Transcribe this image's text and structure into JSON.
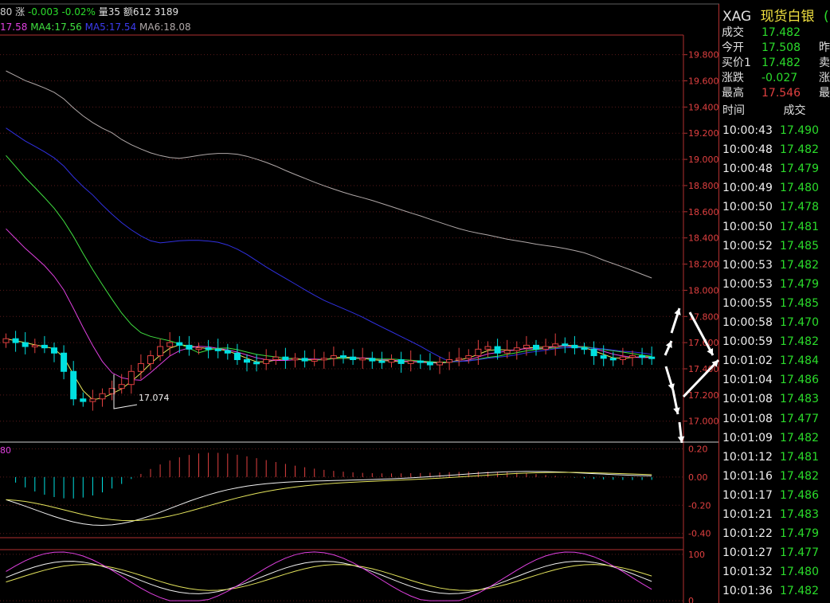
{
  "header": {
    "top_info": {
      "prefix": "80",
      "change_label": "涨",
      "change_value": "-0.003",
      "change_pct": "-0.02%",
      "volume_label": "量35",
      "amount_label": "额612",
      "amount_extra": "3189"
    },
    "ma_info": {
      "ma3_value": "17.58",
      "ma4_label": "MA4:17.56",
      "ma5_label": "MA5:17.54",
      "ma6_label": "MA6:18.08"
    }
  },
  "colors": {
    "up": "#e04040",
    "down": "#00e0e0",
    "ma3": "#e4e45c",
    "ma4": "#40e040",
    "ma5": "#3030e0",
    "ma6": "#b0a8a8",
    "ma_pink": "#e040e0",
    "axis_border": "#b03030",
    "quote_green": "#2bdc2b",
    "quote_red": "#e04040"
  },
  "chart_data": [
    {
      "type": "candlestick",
      "y_ticks": [
        "19.800",
        "19.600",
        "19.400",
        "19.200",
        "19.000",
        "18.800",
        "18.600",
        "18.400",
        "18.200",
        "18.000",
        "17.800",
        "17.600",
        "17.400",
        "17.200",
        "17.000"
      ],
      "ylim": [
        16.84,
        19.95
      ],
      "annotation": "17.074"
    },
    {
      "type": "bar",
      "indicator": "MACD",
      "label": "80",
      "y_ticks": [
        "0.20",
        "0.00",
        "-0.20",
        "-0.40"
      ],
      "ylim": [
        -0.43,
        0.22
      ]
    },
    {
      "type": "line",
      "indicator": "KDJ",
      "y_ticks": [
        "100",
        "0"
      ],
      "ylim": [
        -5,
        110
      ]
    }
  ],
  "panel": {
    "symbol": "XAG",
    "name": "现货白银",
    "name_cut": "(",
    "quotes": [
      {
        "label": "成交",
        "value": "17.482",
        "color": "#2bdc2b",
        "cut": ""
      },
      {
        "label": "今开",
        "value": "17.508",
        "color": "#2bdc2b",
        "cut": "昨"
      },
      {
        "label": "买价1",
        "value": "17.482",
        "color": "#2bdc2b",
        "cut": "卖"
      },
      {
        "label": "涨跌",
        "value": "-0.027",
        "color": "#2bdc2b",
        "cut": "涨"
      },
      {
        "label": "最高",
        "value": "17.546",
        "color": "#e04040",
        "cut": "最"
      }
    ],
    "trade_header": {
      "time": "时间",
      "price": "成交"
    },
    "trades": [
      {
        "time": "10:00:43",
        "price": "17.490"
      },
      {
        "time": "10:00:48",
        "price": "17.482"
      },
      {
        "time": "10:00:48",
        "price": "17.479"
      },
      {
        "time": "10:00:49",
        "price": "17.480"
      },
      {
        "time": "10:00:50",
        "price": "17.478"
      },
      {
        "time": "10:00:50",
        "price": "17.481"
      },
      {
        "time": "10:00:52",
        "price": "17.485"
      },
      {
        "time": "10:00:53",
        "price": "17.482"
      },
      {
        "time": "10:00:53",
        "price": "17.479"
      },
      {
        "time": "10:00:55",
        "price": "17.485"
      },
      {
        "time": "10:00:58",
        "price": "17.470"
      },
      {
        "time": "10:00:59",
        "price": "17.482"
      },
      {
        "time": "10:01:02",
        "price": "17.484"
      },
      {
        "time": "10:01:04",
        "price": "17.486"
      },
      {
        "time": "10:01:08",
        "price": "17.483"
      },
      {
        "time": "10:01:08",
        "price": "17.477"
      },
      {
        "time": "10:01:09",
        "price": "17.482"
      },
      {
        "time": "10:01:12",
        "price": "17.481"
      },
      {
        "time": "10:01:16",
        "price": "17.482"
      },
      {
        "time": "10:01:17",
        "price": "17.486"
      },
      {
        "time": "10:01:21",
        "price": "17.483"
      },
      {
        "time": "10:01:22",
        "price": "17.479"
      },
      {
        "time": "10:01:27",
        "price": "17.477"
      },
      {
        "time": "10:01:32",
        "price": "17.480"
      },
      {
        "time": "10:01:36",
        "price": "17.482"
      }
    ]
  }
}
